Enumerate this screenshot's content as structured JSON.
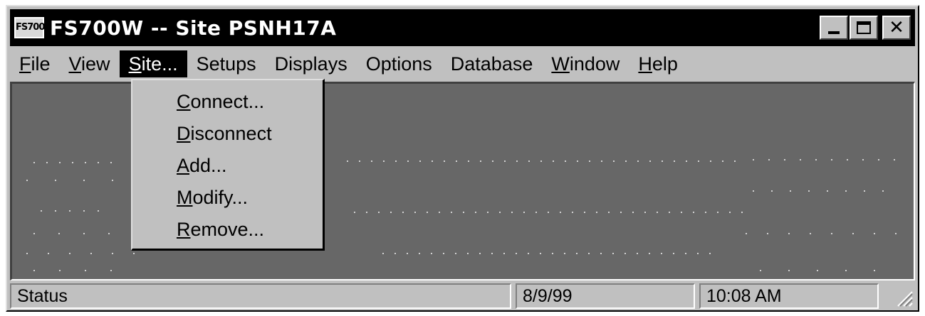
{
  "window": {
    "icon_text": "FS700",
    "title": "FS700W -- Site PSNH17A",
    "minimize_label": "",
    "maximize_label": "",
    "close_label": "✕"
  },
  "menubar": {
    "items": [
      {
        "first": "F",
        "rest": "ile"
      },
      {
        "first": "V",
        "rest": "iew"
      },
      {
        "first": "S",
        "rest": "ite..."
      },
      {
        "first": "",
        "rest": "Setups"
      },
      {
        "first": "",
        "rest": "Displays"
      },
      {
        "first": "",
        "rest": "Options"
      },
      {
        "first": "",
        "rest": "Database"
      },
      {
        "first": "W",
        "rest": "indow"
      },
      {
        "first": "H",
        "rest": "elp"
      }
    ],
    "active_index": 2
  },
  "site_menu": {
    "items": [
      {
        "first": "C",
        "rest": "onnect..."
      },
      {
        "first": "D",
        "rest": "isconnect"
      },
      {
        "first": "A",
        "rest": "dd..."
      },
      {
        "first": "M",
        "rest": "odify..."
      },
      {
        "first": "R",
        "rest": "emove..."
      }
    ]
  },
  "statusbar": {
    "status": "Status",
    "date": "8/9/99",
    "time": "10:08 AM"
  },
  "colors": {
    "titlebar": "#000000",
    "client_bg": "#676767",
    "chrome": "#c0c0c0",
    "dots": "#d0d0d0"
  }
}
